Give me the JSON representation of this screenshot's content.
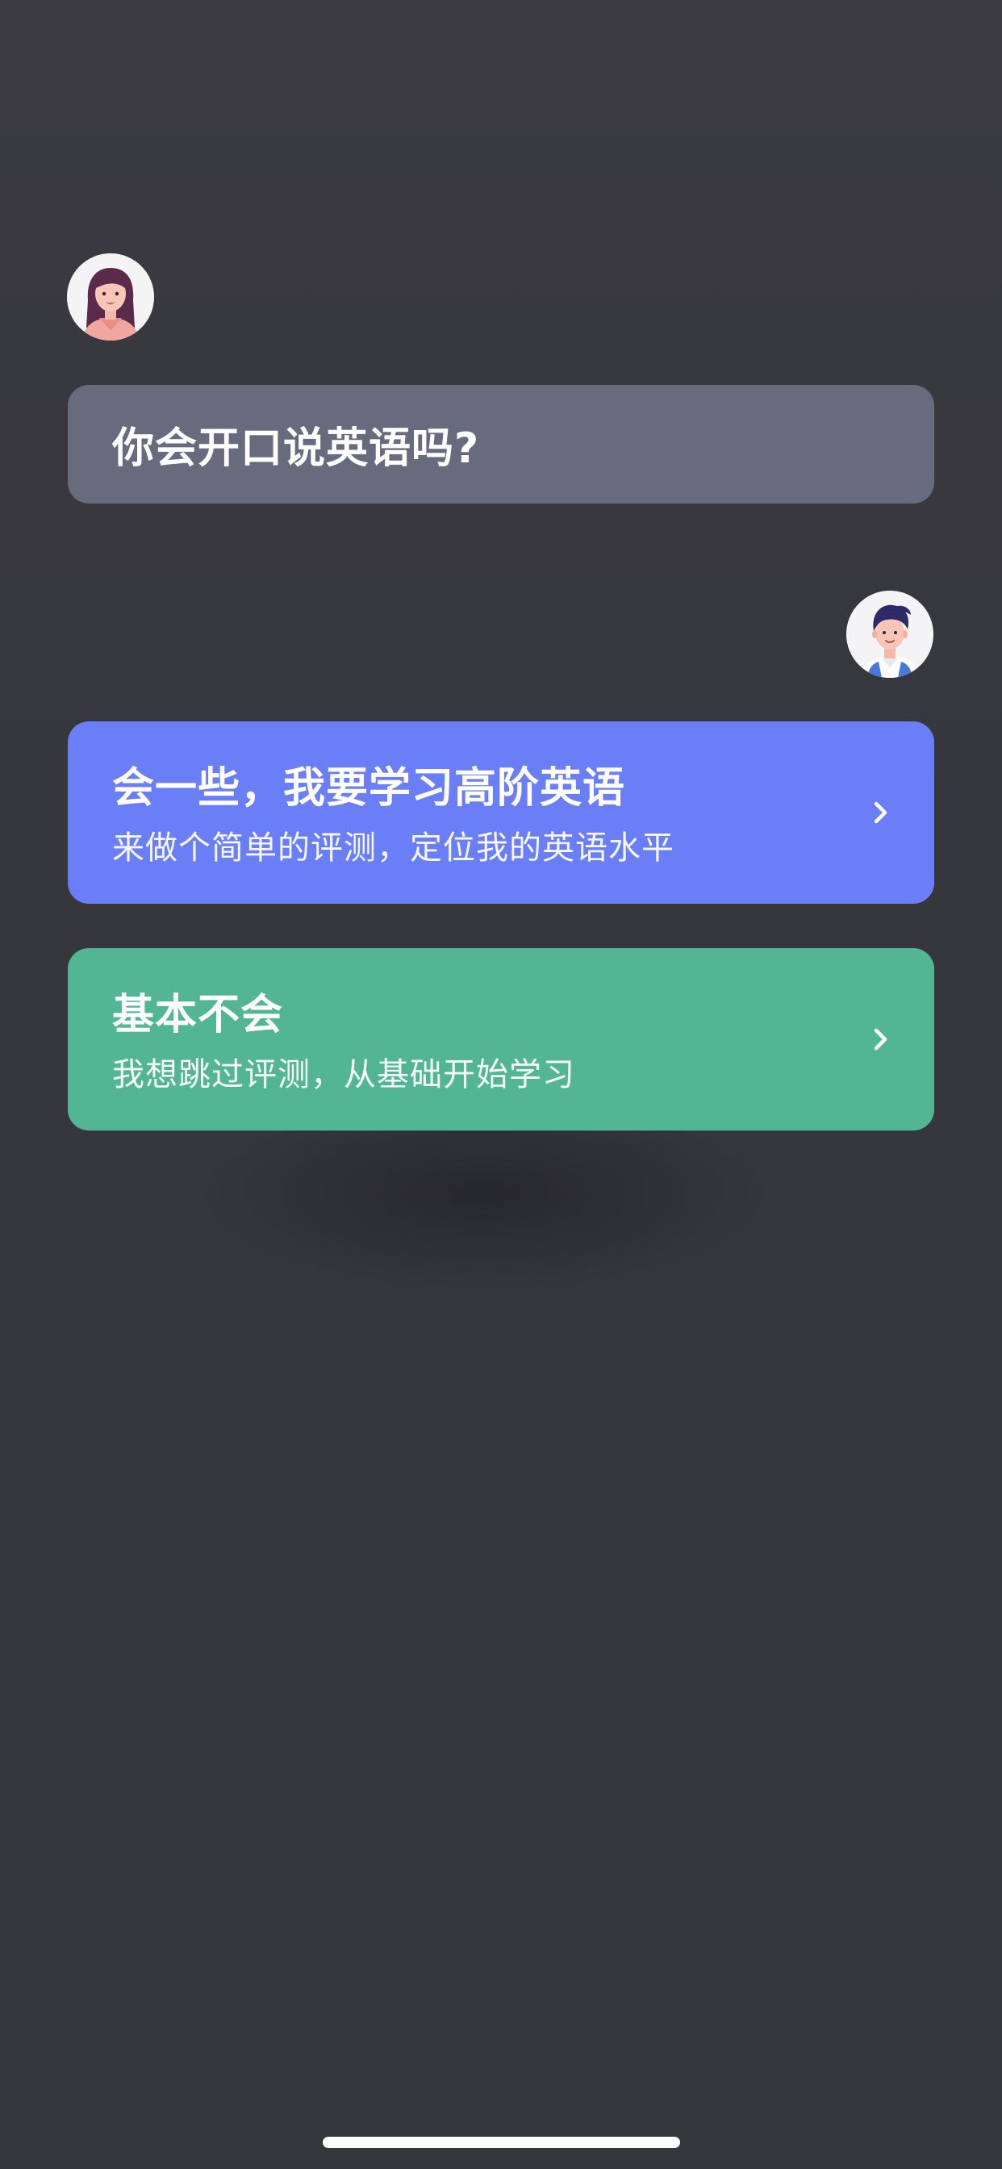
{
  "chat": {
    "tutor_avatar_icon": "female-tutor-avatar",
    "question": "你会开口说英语吗?",
    "user_avatar_icon": "male-user-avatar"
  },
  "options": [
    {
      "title": "会一些，我要学习高阶英语",
      "subtitle": "来做个简单的评测，定位我的英语水平",
      "color": "#6a7ef7",
      "icon": "chevron-right-icon"
    },
    {
      "title": "基本不会",
      "subtitle": "我想跳过评测，从基础开始学习",
      "color": "#52b594",
      "icon": "chevron-right-icon"
    }
  ],
  "colors": {
    "background": "#36363d",
    "question_bubble": "#676b7d"
  }
}
